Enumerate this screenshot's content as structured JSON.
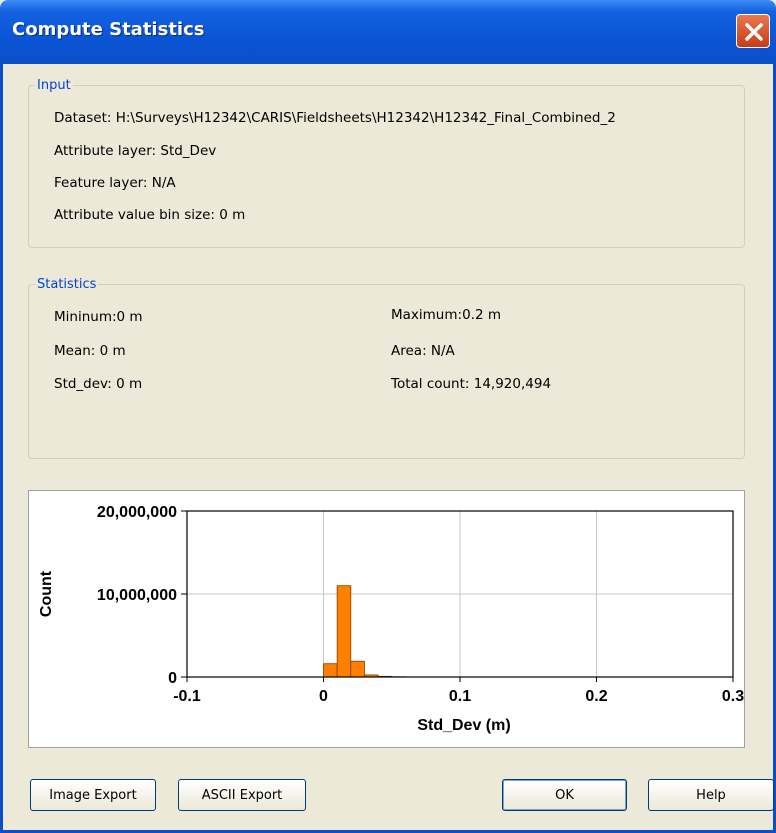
{
  "window": {
    "title": "Compute Statistics"
  },
  "input": {
    "legend": "Input",
    "dataset": "Dataset: H:\\Surveys\\H12342\\CARIS\\Fieldsheets\\H12342\\H12342_Final_Combined_2",
    "attribute_layer": "Attribute layer: Std_Dev",
    "feature_layer": "Feature layer: N/A",
    "bin_size": "Attribute value bin size: 0 m"
  },
  "statistics": {
    "legend": "Statistics",
    "minimum": "Mininum:0 m",
    "mean": "Mean: 0 m",
    "std_dev": "Std_dev: 0 m",
    "maximum": "Maximum:0.2 m",
    "area": "Area: N/A",
    "total_count": "Total count: 14,920,494"
  },
  "chart_data": {
    "type": "bar",
    "xlabel": "Std_Dev (m)",
    "ylabel": "Count",
    "xlim": [
      -0.1,
      0.3
    ],
    "ylim": [
      0,
      20000000
    ],
    "xticks": [
      -0.1,
      0,
      0.1,
      0.2,
      0.3
    ],
    "xtick_labels": [
      "-0.1",
      "0",
      "0.1",
      "0.2",
      "0.3"
    ],
    "yticks": [
      0,
      10000000,
      20000000
    ],
    "ytick_labels": [
      "0",
      "10,000,000",
      "20,000,000"
    ],
    "grid": true,
    "bar_color": "#ff8000",
    "bin_width": 0.01,
    "bins": [
      {
        "x": 0.0,
        "value": 1600000
      },
      {
        "x": 0.01,
        "value": 11000000
      },
      {
        "x": 0.02,
        "value": 1900000
      },
      {
        "x": 0.03,
        "value": 250000
      },
      {
        "x": 0.04,
        "value": 80000
      },
      {
        "x": 0.05,
        "value": 30000
      }
    ]
  },
  "buttons": {
    "image_export": "Image Export",
    "ascii_export": "ASCII Export",
    "ok": "OK",
    "help": "Help"
  }
}
